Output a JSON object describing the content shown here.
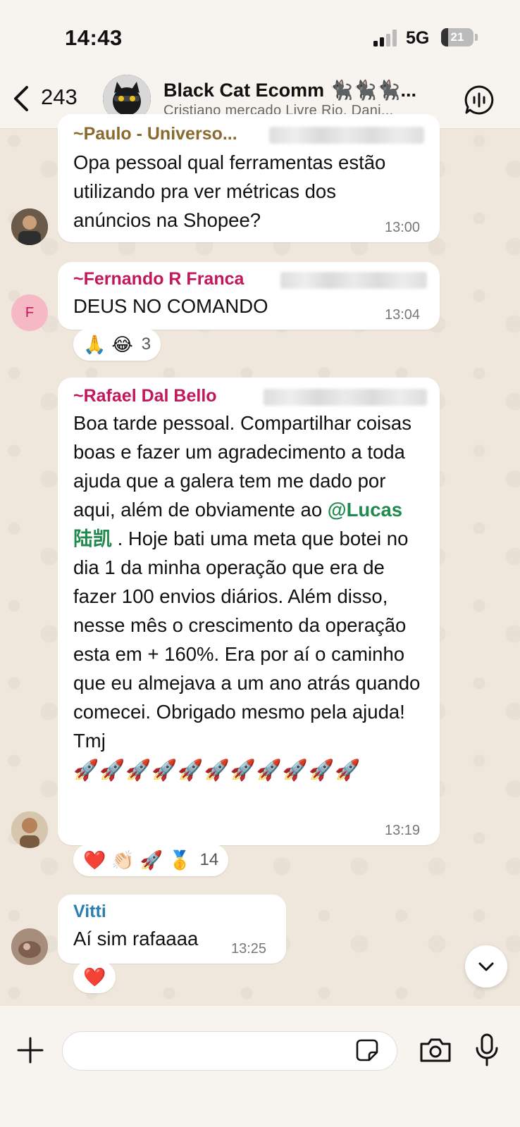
{
  "status": {
    "time": "14:43",
    "network": "5G",
    "battery": "21"
  },
  "header": {
    "back_count": "243",
    "group_name": "Black Cat Ecomm 🐈‍⬛🐈‍⬛🐈‍⬛...",
    "members": "Cristiano mercado Livre Rio, Dani..."
  },
  "messages": [
    {
      "sender": "~Paulo - Universo...",
      "text": "Opa pessoal qual ferramentas estão utilizando pra ver métricas dos anúncios na Shopee?",
      "time": "13:00"
    },
    {
      "sender": "~Fernando R Franca",
      "avatar_letter": "F",
      "text": "DEUS NO COMANDO",
      "time": "13:04",
      "reactions": [
        "🙏",
        "😂"
      ],
      "reaction_count": "3"
    },
    {
      "sender": "~Rafael Dal Bello",
      "text_before_mention": "Boa tarde pessoal. Compartilhar coisas boas e fazer um agradecimento a toda ajuda que a galera tem me dado por aqui, além de obviamente ao ",
      "mention": "@Lucas 陆凯",
      "text_after_mention": " . Hoje bati uma meta que botei no dia 1 da minha operação que era de fazer 100 envios diários. Além disso, nesse mês o crescimento da operação esta em + 160%. Era por aí o caminho que eu almejava a um ano atrás quando comecei. Obrigado  mesmo pela ajuda! Tmj",
      "emoji_line": "🚀🚀🚀🚀🚀🚀🚀🚀🚀🚀🚀",
      "time": "13:19",
      "reactions": [
        "❤️",
        "👏🏻",
        "🚀",
        "🥇"
      ],
      "reaction_count": "14"
    },
    {
      "sender": "Vitti",
      "text": "Aí sim rafaaaa",
      "time": "13:25",
      "reactions": [
        "❤️"
      ]
    }
  ],
  "colors": {
    "paulo": "#8a6a2e",
    "fernando": "#c2185b",
    "rafael": "#c2185b",
    "vitti": "#2a7fb0",
    "mention": "#1f8a4c"
  }
}
